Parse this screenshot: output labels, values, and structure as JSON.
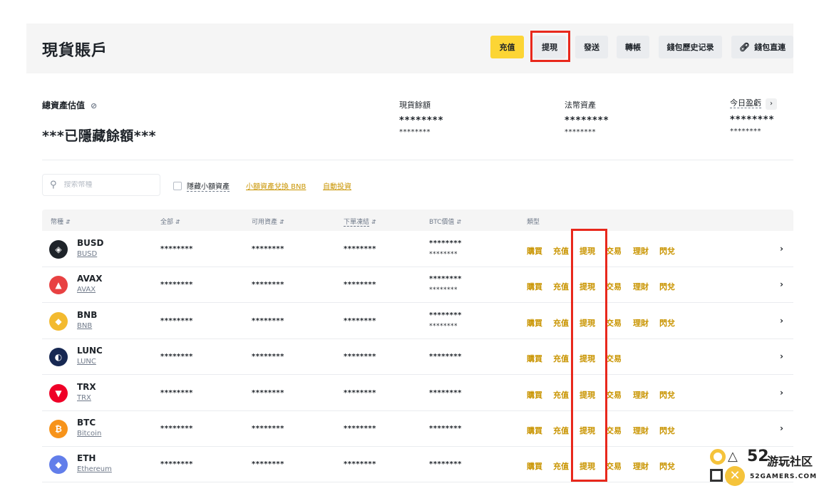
{
  "header": {
    "title": "現貨賬戶",
    "buttons": {
      "deposit": "充值",
      "withdraw": "提現",
      "send": "發送",
      "transfer": "轉帳",
      "wallet_history": "錢包歷史记录",
      "wallet_direct": "錢包直連"
    }
  },
  "summary": {
    "total_label": "總資產估值",
    "total_value": "***已隱藏餘額***",
    "spot_label": "現貨餘額",
    "spot_value": "********",
    "spot_sub": "********",
    "fiat_label": "法幣資產",
    "fiat_value": "********",
    "fiat_sub": "********",
    "pnl_label": "今日盈虧",
    "pnl_value": "********",
    "pnl_sub": "********"
  },
  "filters": {
    "search_placeholder": "搜索幣種",
    "hide_small": "隱藏小額資產",
    "convert_link": "小額資產兌換 BNB",
    "auto_invest_link": "自動投資"
  },
  "table": {
    "headers": {
      "coin": "幣種",
      "total": "全部",
      "available": "可用資產",
      "in_order": "下單凍結",
      "btc_value": "BTC價值",
      "type": "類型"
    },
    "actions": {
      "buy": "購買",
      "deposit": "充值",
      "withdraw": "提現",
      "trade": "交易",
      "earn": "理財",
      "convert": "閃兌"
    },
    "rows": [
      {
        "symbol": "BUSD",
        "name": "BUSD",
        "total": "********",
        "available": "********",
        "in_order": "********",
        "btc": "********",
        "btc_sub": "********",
        "has_earn": true
      },
      {
        "symbol": "AVAX",
        "name": "AVAX",
        "total": "********",
        "available": "********",
        "in_order": "********",
        "btc": "********",
        "btc_sub": "********",
        "has_earn": true
      },
      {
        "symbol": "BNB",
        "name": "BNB",
        "total": "********",
        "available": "********",
        "in_order": "********",
        "btc": "********",
        "btc_sub": "********",
        "has_earn": true
      },
      {
        "symbol": "LUNC",
        "name": "LUNC",
        "total": "********",
        "available": "********",
        "in_order": "********",
        "btc": "********",
        "btc_sub": "",
        "has_earn": false
      },
      {
        "symbol": "TRX",
        "name": "TRX",
        "total": "********",
        "available": "********",
        "in_order": "********",
        "btc": "********",
        "btc_sub": "",
        "has_earn": true
      },
      {
        "symbol": "BTC",
        "name": "Bitcoin",
        "total": "********",
        "available": "********",
        "in_order": "********",
        "btc": "********",
        "btc_sub": "",
        "has_earn": true
      },
      {
        "symbol": "ETH",
        "name": "Ethereum",
        "total": "********",
        "available": "********",
        "in_order": "********",
        "btc": "********",
        "btc_sub": "",
        "has_earn": true
      }
    ]
  },
  "coin_colors": {
    "BUSD": "#1e2329",
    "AVAX": "#e84142",
    "BNB": "#f3ba2f",
    "LUNC": "#172852",
    "TRX": "#ef0027",
    "BTC": "#f7931a",
    "ETH": "#627eea"
  },
  "watermark": {
    "number": "52",
    "cn": "游玩社区",
    "en": "52GAMERS.COM"
  },
  "colors": {
    "accent": "#fcd535",
    "gold_text": "#c99400",
    "highlight": "#e8281c"
  }
}
